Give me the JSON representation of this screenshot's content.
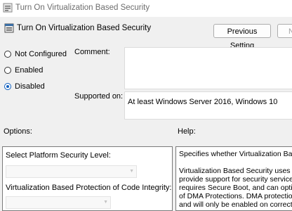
{
  "window": {
    "title": "Turn On Virtualization Based Security",
    "icon": "policy-setting-icon"
  },
  "header": {
    "policy_name": "Turn On Virtualization Based Security",
    "previous_label": "Previous Setting",
    "next_label": "N"
  },
  "state": {
    "options": [
      {
        "label": "Not Configured",
        "checked": false
      },
      {
        "label": "Enabled",
        "checked": false
      },
      {
        "label": "Disabled",
        "checked": true
      }
    ]
  },
  "comment": {
    "label": "Comment:",
    "value": ""
  },
  "supported": {
    "label": "Supported on:",
    "value": "At least Windows Server 2016, Windows 10"
  },
  "options_panel": {
    "heading": "Options:",
    "platform_label": "Select Platform Security Level:",
    "platform_value": "",
    "code_integrity_label": "Virtualization Based Protection of Code Integrity:",
    "code_integrity_value": ""
  },
  "help_panel": {
    "heading": "Help:",
    "lines": [
      "Specifies whether Virtualization Based",
      "",
      "Virtualization Based Security uses the W",
      "provide support for security services. V",
      "requires Secure Boot, and can optional",
      "of DMA Protections. DMA protections r",
      "and will only be enabled on correctly"
    ]
  },
  "colors": {
    "accent": "#0f5fbf",
    "window_bg": "#f0f0f0",
    "disabled_text": "#a0a0a0"
  }
}
